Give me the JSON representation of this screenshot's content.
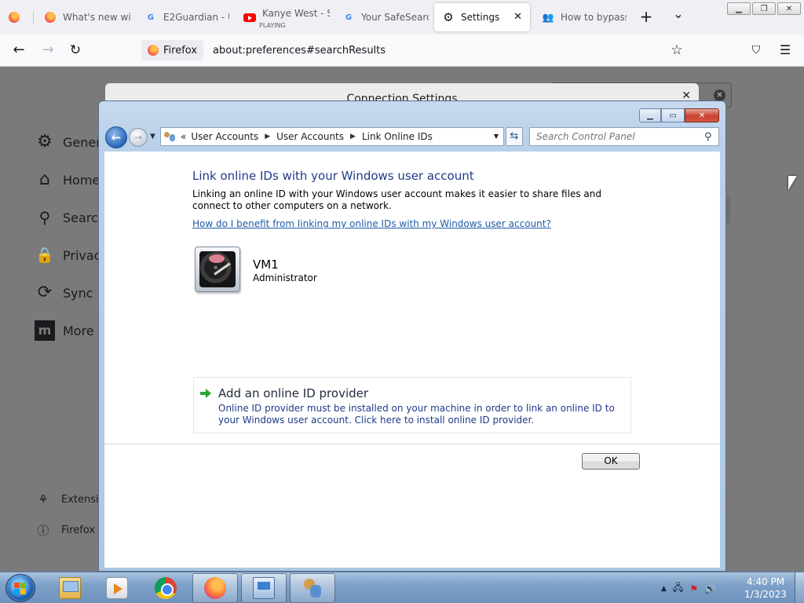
{
  "browser": {
    "tabs": [
      {
        "title": "",
        "icon": "firefox-icon"
      },
      {
        "title": "What's new wit",
        "icon": "firefox-icon"
      },
      {
        "title": "E2Guardian - U",
        "icon": "google-icon"
      },
      {
        "title": "Kanye West - St",
        "subtitle": "PLAYING",
        "icon": "youtube-icon"
      },
      {
        "title": "Your SafeSearch",
        "icon": "google-icon"
      },
      {
        "title": "Settings",
        "icon": "gear-icon",
        "active": true
      },
      {
        "title": "How to bypass",
        "icon": "people-icon"
      }
    ],
    "new_tab_label": "+",
    "tab_list_label": "⌄",
    "identity_label": "Firefox",
    "url": "about:preferences#searchResults"
  },
  "prefs": {
    "nav_items": [
      "Genera",
      "Home",
      "Search",
      "Privacy",
      "Sync",
      "More f"
    ],
    "footer_items": [
      "Extensio",
      "Firefox S"
    ],
    "dialog_title": "Connection Settings"
  },
  "control_panel": {
    "breadcrumb": [
      "User Accounts",
      "User Accounts",
      "Link Online IDs"
    ],
    "breadcrumb_prefix": "«",
    "search_placeholder": "Search Control Panel",
    "heading": "Link online IDs with your Windows user account",
    "description": "Linking an online ID with your Windows user account makes it easier to share files and connect to other computers on a network.",
    "help_link": "How do I benefit from linking my online IDs with my Windows user account?",
    "user_name": "VM1",
    "user_role": "Administrator",
    "provider_title": "Add an online ID provider",
    "provider_description": "Online ID provider must be installed on your machine in order to link an online ID to your Windows user account. Click here to install online ID provider.",
    "ok_label": "OK"
  },
  "taskbar": {
    "time": "4:40 PM",
    "date": "1/3/2023"
  },
  "colors": {
    "link_blue": "#1e5ba8",
    "heading_blue": "#1e3b8a",
    "window_frame": "#b9d0ea"
  }
}
